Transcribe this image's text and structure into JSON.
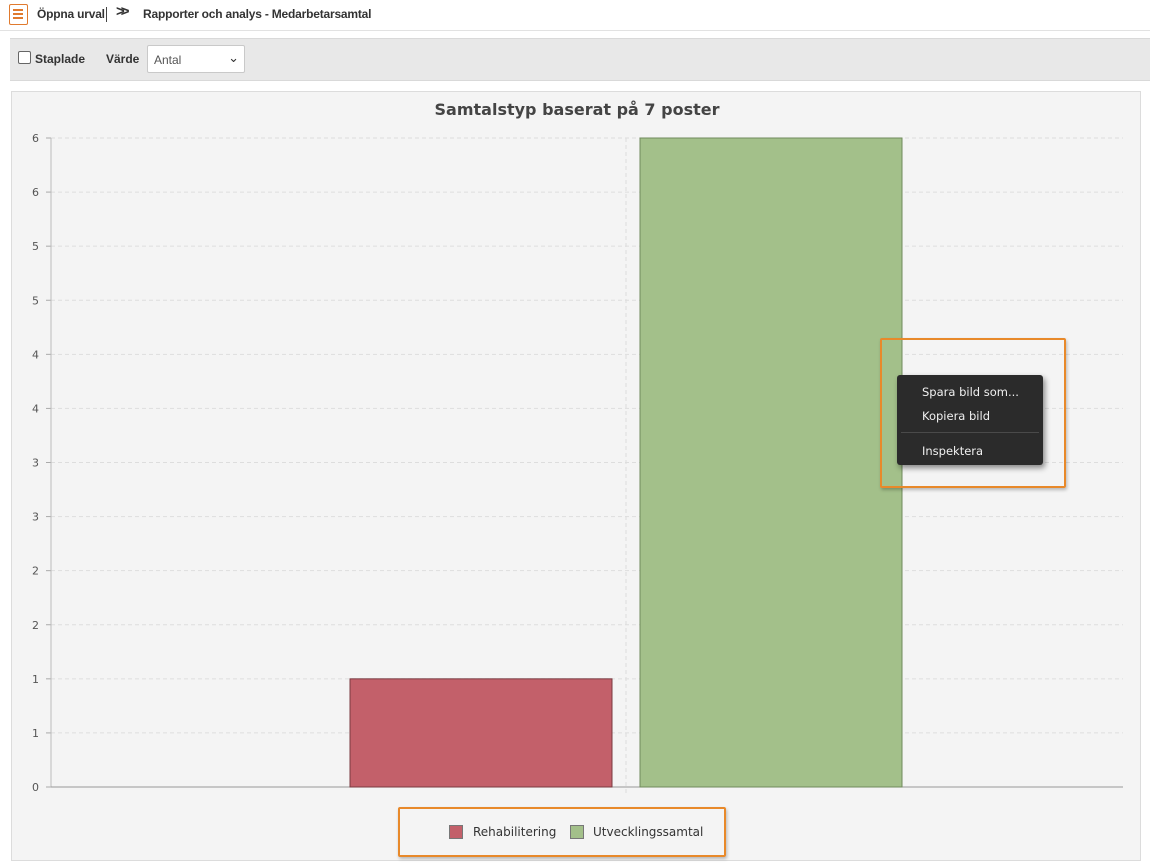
{
  "breadcrumb": {
    "open_selection": "Öppna urval",
    "current": "Rapporter och analys - Medarbetarsamtal"
  },
  "toolbar": {
    "stacked_label": "Staplade",
    "stacked_checked": false,
    "value_label": "Värde",
    "value_selected": "Antal"
  },
  "colors": {
    "accent": "#e8892a",
    "rehab": "#c3606a",
    "utveckling": "#a3c08a"
  },
  "chart_data": {
    "type": "bar",
    "title": "Samtalstyp baserat på 7 poster",
    "categories": [
      ""
    ],
    "series": [
      {
        "name": "Rehabilitering",
        "values": [
          1
        ],
        "color": "#c3606a"
      },
      {
        "name": "Utvecklingssamtal",
        "values": [
          6
        ],
        "color": "#a3c08a"
      }
    ],
    "ylim": [
      0,
      6
    ],
    "yticks": [
      0,
      0.5,
      1,
      1.5,
      2,
      2.5,
      3,
      3.5,
      4,
      4.5,
      5,
      5.5,
      6
    ],
    "ytick_labels": [
      "0",
      "1",
      "1",
      "2",
      "2",
      "3",
      "3",
      "4",
      "4",
      "5",
      "5",
      "6",
      "6"
    ],
    "xlabel": "",
    "ylabel": "",
    "grid": true,
    "legend_position": "bottom"
  },
  "context_menu": {
    "items": [
      "Spara bild som...",
      "Kopiera bild",
      "Inspektera"
    ]
  }
}
